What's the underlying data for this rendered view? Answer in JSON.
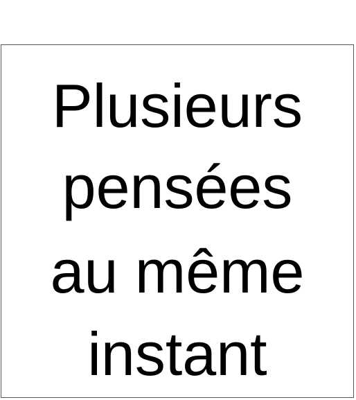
{
  "card": {
    "lines": [
      "Plusieurs",
      "pensées",
      "au même",
      "instant"
    ]
  }
}
